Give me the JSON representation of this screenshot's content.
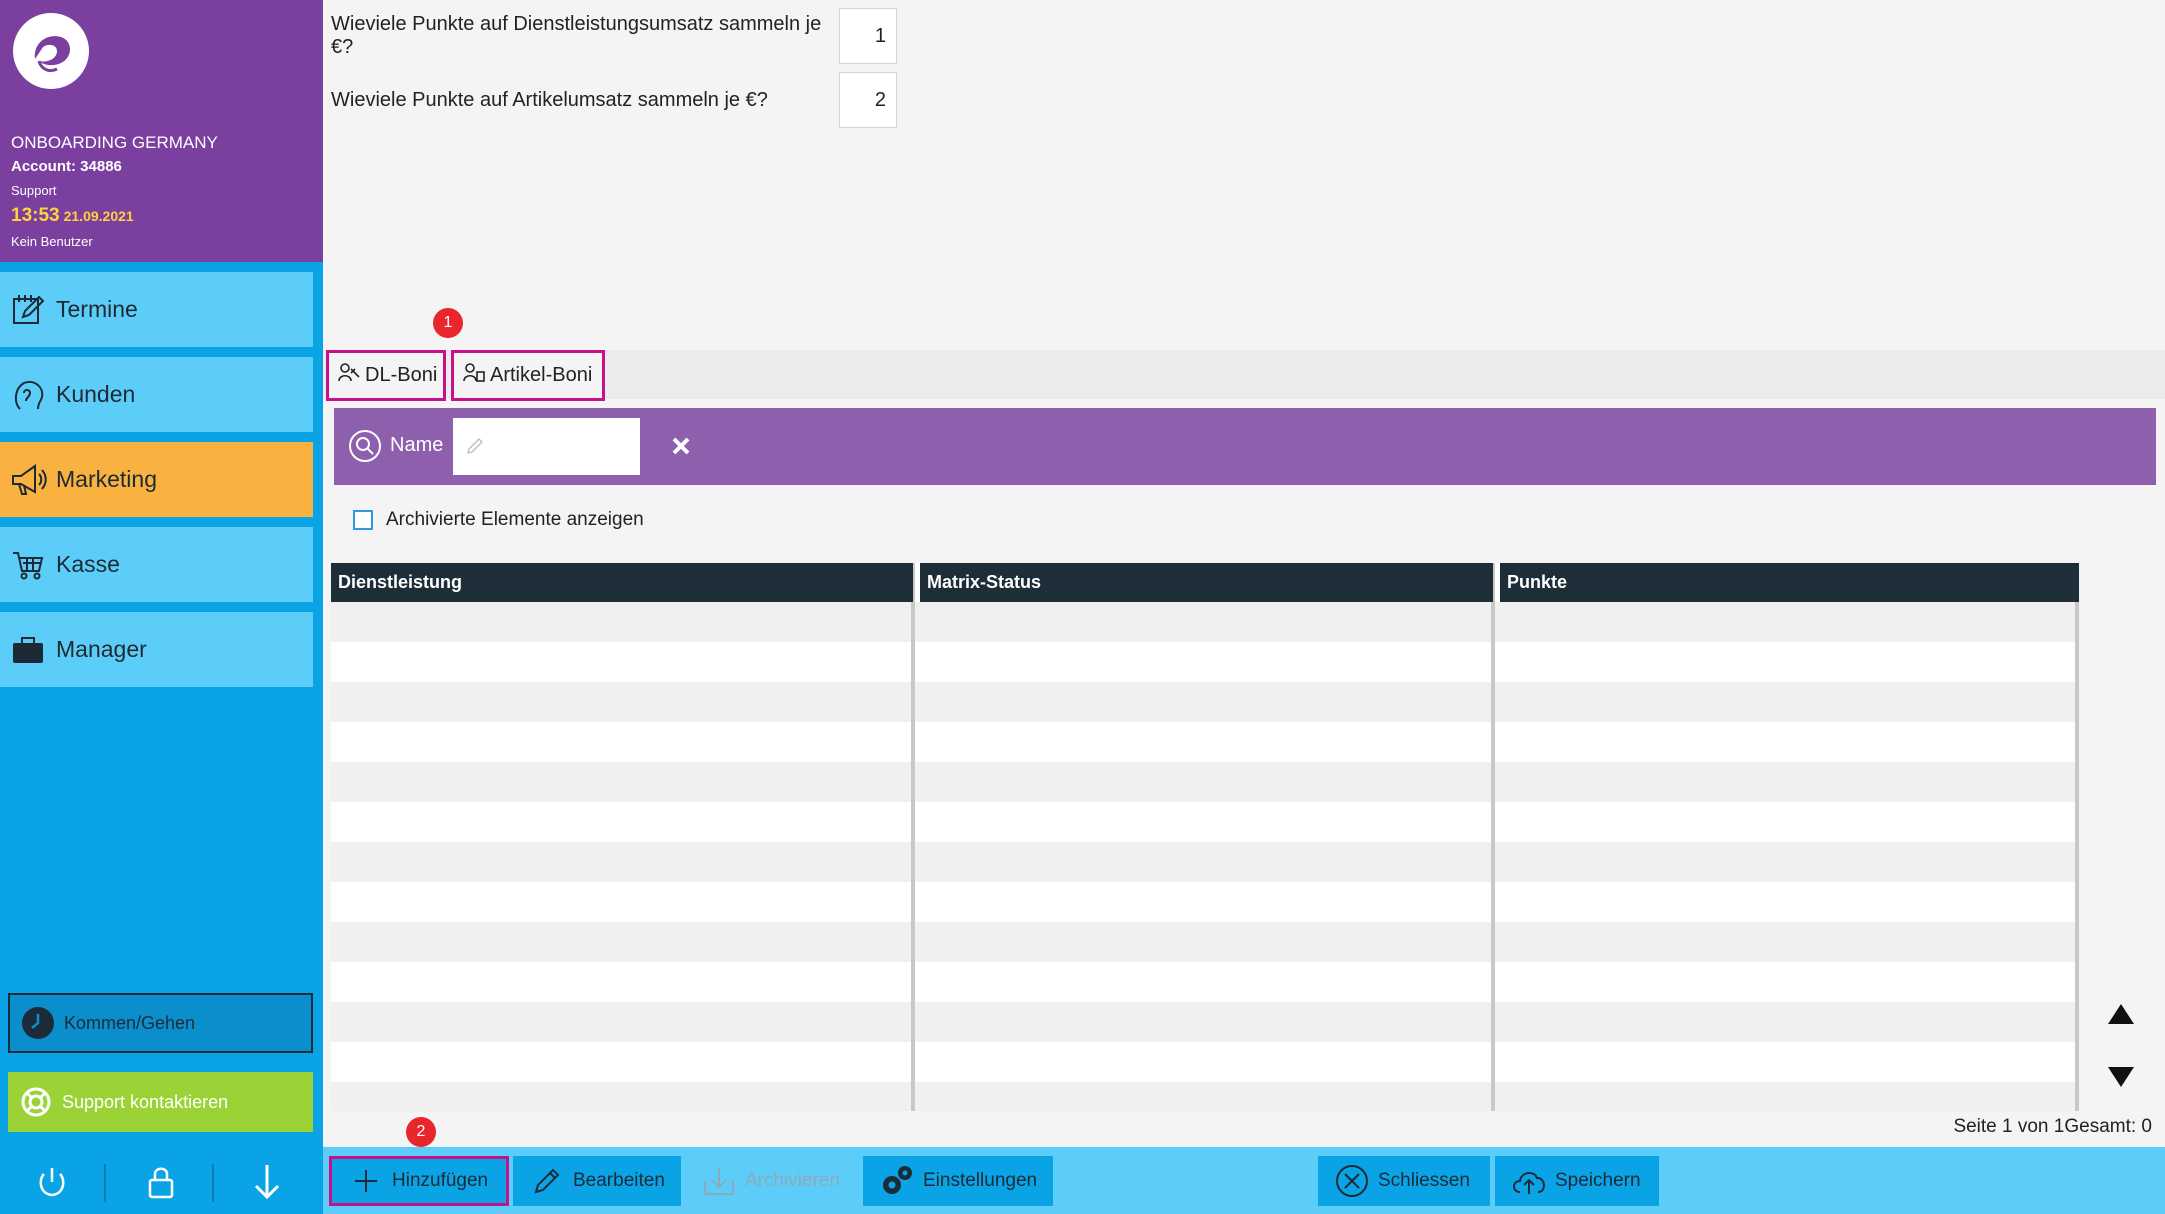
{
  "sidebar": {
    "org_name": "ONBOARDING GERMANY",
    "account": "Account: 34886",
    "role": "Support",
    "time": "13:53",
    "date": "21.09.2021",
    "user": "Kein Benutzer",
    "nav": [
      {
        "label": "Termine",
        "icon": "calendar-edit-icon"
      },
      {
        "label": "Kunden",
        "icon": "customer-head-icon"
      },
      {
        "label": "Marketing",
        "icon": "megaphone-icon",
        "active": true
      },
      {
        "label": "Kasse",
        "icon": "cart-icon"
      },
      {
        "label": "Manager",
        "icon": "briefcase-icon"
      }
    ],
    "kommen_gehen": "Kommen/Gehen",
    "support": "Support kontaktieren",
    "footer_icons": [
      "power-icon",
      "lock-icon",
      "arrow-down-icon"
    ]
  },
  "settings": {
    "q1_label": "Wieviele Punkte auf Dienstleistungsumsatz sammeln je €?",
    "q1_value": "1",
    "q2_label": "Wieviele Punkte auf Artikelumsatz sammeln je €?",
    "q2_value": "2"
  },
  "badges": {
    "tabs": "1",
    "add": "2"
  },
  "tabs": [
    {
      "label": "DL-Boni"
    },
    {
      "label": "Artikel-Boni"
    }
  ],
  "search": {
    "label": "Name",
    "value": ""
  },
  "archive_label": "Archivierte Elemente anzeigen",
  "table": {
    "columns": [
      "Dienstleistung",
      "Matrix-Status",
      "Punkte"
    ],
    "rows": []
  },
  "pager": {
    "text": "Seite 1 von 1Gesamt: 0"
  },
  "toolbar": {
    "add": "Hinzufügen",
    "edit": "Bearbeiten",
    "archive": "Archivieren",
    "settings": "Einstellungen",
    "close": "Schliessen",
    "save": "Speichern"
  },
  "colors": {
    "sidebar_bg": "#0aa4e6",
    "header_purple": "#7b3fa0",
    "nav_item": "#5ccdf8",
    "nav_active": "#f9b23f",
    "search_bar": "#8e5fac",
    "highlight": "#c7118a",
    "table_header": "#1d2e38"
  }
}
